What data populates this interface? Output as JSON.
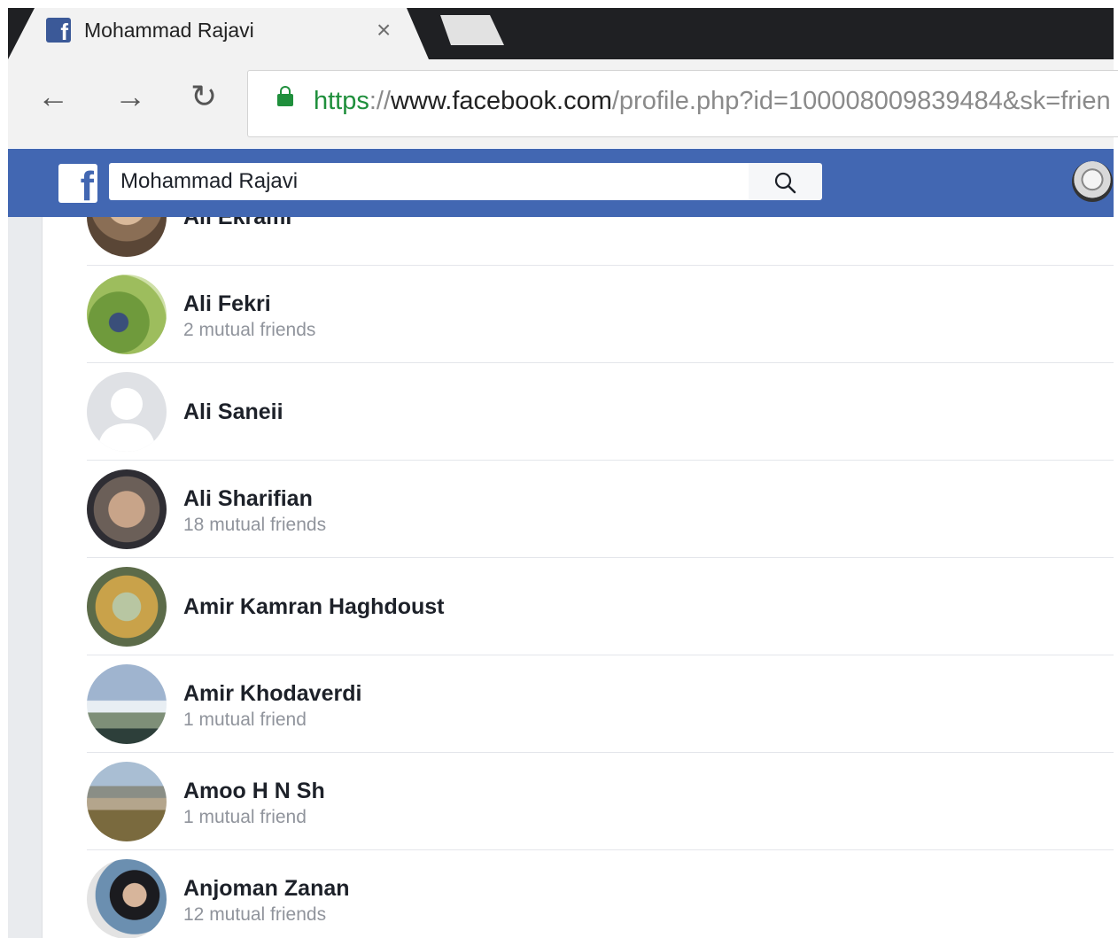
{
  "browser": {
    "tab_title": "Mohammad Rajavi",
    "tab_close": "×",
    "url_scheme": "https",
    "url_sep": "://",
    "url_host": "www.facebook.com",
    "url_path": "/profile.php?id=100008009839484&sk=frien",
    "back_icon": "←",
    "forward_icon": "→",
    "reload_icon": "↻"
  },
  "facebook": {
    "logo": "f",
    "search_value": "Mohammad Rajavi"
  },
  "friends": [
    {
      "name": "Ali Ekrami",
      "mutual": ""
    },
    {
      "name": "Ali Fekri",
      "mutual": "2 mutual friends"
    },
    {
      "name": "Ali Saneii",
      "mutual": ""
    },
    {
      "name": "Ali Sharifian",
      "mutual": "18 mutual friends"
    },
    {
      "name": "Amir Kamran Haghdoust",
      "mutual": ""
    },
    {
      "name": "Amir Khodaverdi",
      "mutual": "1 mutual friend"
    },
    {
      "name": "Amoo H N Sh",
      "mutual": "1 mutual friend"
    },
    {
      "name": "Anjoman Zanan",
      "mutual": "12 mutual friends"
    }
  ],
  "colors": {
    "facebook_blue": "#4267b2",
    "secure_green": "#1f8f3c"
  }
}
